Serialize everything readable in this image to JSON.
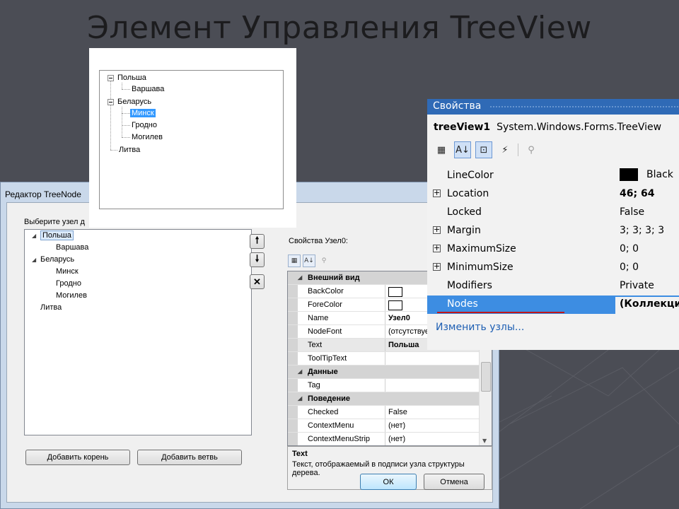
{
  "slide": {
    "title": "Элемент Управления  TreeView"
  },
  "preview_tree": {
    "nodes": [
      {
        "label": "Польша"
      },
      {
        "label": "Варшава"
      },
      {
        "label": "Беларусь"
      },
      {
        "label": "Минск"
      },
      {
        "label": "Гродно"
      },
      {
        "label": "Могилев"
      },
      {
        "label": "Литва"
      }
    ]
  },
  "editor": {
    "title": "Редактор TreeNode",
    "select_label": "Выберите узел д",
    "nodes": [
      {
        "label": "Польша"
      },
      {
        "label": "Варшава"
      },
      {
        "label": "Беларусь"
      },
      {
        "label": "Минск"
      },
      {
        "label": "Гродно"
      },
      {
        "label": "Могилев"
      },
      {
        "label": "Литва"
      }
    ],
    "props_label": "Свойства Узел0:",
    "move_up": "🠕",
    "move_down": "🠗",
    "delete": "✕",
    "add_root": "Добавить корень",
    "add_child": "Добавить ветвь",
    "ok": "ОК",
    "cancel": "Отмена",
    "grid": {
      "cat_appearance": "Внешний вид",
      "cat_data": "Данные",
      "cat_behavior": "Поведение",
      "rows": {
        "backcolor": {
          "name": "BackColor",
          "value": ""
        },
        "forecolor": {
          "name": "ForeColor",
          "value": ""
        },
        "name": {
          "name": "Name",
          "value": "Узел0"
        },
        "nodefont": {
          "name": "NodeFont",
          "value": "(отсутствует)"
        },
        "text": {
          "name": "Text",
          "value": "Польша"
        },
        "tooltip": {
          "name": "ToolTipText",
          "value": ""
        },
        "tag": {
          "name": "Tag",
          "value": ""
        },
        "checked": {
          "name": "Checked",
          "value": "False"
        },
        "contextmenu": {
          "name": "ContextMenu",
          "value": "(нет)"
        },
        "contextmenustrip": {
          "name": "ContextMenuStrip",
          "value": "(нет)"
        }
      }
    },
    "description": {
      "title": "Text",
      "body": "Текст, отображаемый в подписи узла структуры дерева."
    }
  },
  "properties": {
    "header": "Свойства",
    "object_name": "treeView1",
    "object_type": "System.Windows.Forms.TreeView",
    "rows": {
      "linecolor": {
        "name": "LineColor",
        "value": "Black"
      },
      "location": {
        "name": "Location",
        "value": "46; 64"
      },
      "locked": {
        "name": "Locked",
        "value": "False"
      },
      "margin": {
        "name": "Margin",
        "value": "3; 3; 3; 3"
      },
      "maxsize": {
        "name": "MaximumSize",
        "value": "0; 0"
      },
      "minsize": {
        "name": "MinimumSize",
        "value": "0; 0"
      },
      "modifiers": {
        "name": "Modifiers",
        "value": "Private"
      },
      "nodes": {
        "name": "Nodes",
        "value": "(Коллекция)"
      }
    },
    "edit_link": "Изменить узлы..."
  },
  "colors": {
    "background": "#4b4d55",
    "accent_blue": "#2f6ab6",
    "selection": "#3399ff",
    "underline_red": "#c0171b"
  }
}
